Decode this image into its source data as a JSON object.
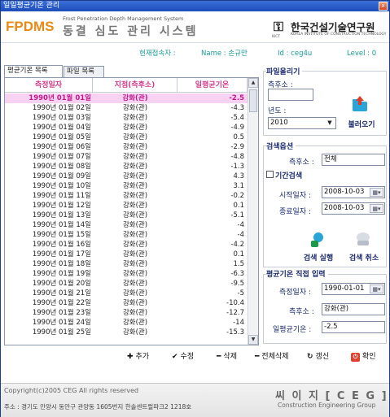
{
  "window": {
    "title": "일일평균기온 관리",
    "close_glyph": "x"
  },
  "header": {
    "logo": "FPDMS",
    "logo_subtitle": "Frost Penetration Depth Management System",
    "logo_title": "동결 심도 관리 시스템",
    "org_name": "한국건설기술연구원",
    "org_english": "KOREA INSTITUTE OF CONSTRUCTION TECHNOLOGY",
    "org_mark": "KICT"
  },
  "userbar": {
    "current_user_label": "현재접속자 :",
    "name_label": "Name : 손규만",
    "id_label": "Id : ceg4u",
    "level_label": "Level : 0"
  },
  "tabs": [
    {
      "label": "평균기온 목록",
      "active": true
    },
    {
      "label": "파일 목록",
      "active": false
    }
  ],
  "grid": {
    "columns": [
      "측정일자",
      "지점(측후소)",
      "일평균기온"
    ],
    "rows": [
      {
        "date": "1990년 01월 01일",
        "site": "강화(관)",
        "temp": "-2.5",
        "selected": true
      },
      {
        "date": "1990년 01월 02일",
        "site": "강화(관)",
        "temp": "-4.3"
      },
      {
        "date": "1990년 01월 03일",
        "site": "강화(관)",
        "temp": "-5.4"
      },
      {
        "date": "1990년 01월 04일",
        "site": "강화(관)",
        "temp": "-4.9"
      },
      {
        "date": "1990년 01월 05일",
        "site": "강화(관)",
        "temp": "0.5"
      },
      {
        "date": "1990년 01월 06일",
        "site": "강화(관)",
        "temp": "-2.9"
      },
      {
        "date": "1990년 01월 07일",
        "site": "강화(관)",
        "temp": "-4.8"
      },
      {
        "date": "1990년 01월 08일",
        "site": "강화(관)",
        "temp": "-1.3"
      },
      {
        "date": "1990년 01월 09일",
        "site": "강화(관)",
        "temp": "4.3"
      },
      {
        "date": "1990년 01월 10일",
        "site": "강화(관)",
        "temp": "3.1"
      },
      {
        "date": "1990년 01월 11일",
        "site": "강화(관)",
        "temp": "-0.2"
      },
      {
        "date": "1990년 01월 12일",
        "site": "강화(관)",
        "temp": "0.1"
      },
      {
        "date": "1990년 01월 13일",
        "site": "강화(관)",
        "temp": "-5.1"
      },
      {
        "date": "1990년 01월 14일",
        "site": "강화(관)",
        "temp": "-4"
      },
      {
        "date": "1990년 01월 15일",
        "site": "강화(관)",
        "temp": "-4"
      },
      {
        "date": "1990년 01월 16일",
        "site": "강화(관)",
        "temp": "-4.2"
      },
      {
        "date": "1990년 01월 17일",
        "site": "강화(관)",
        "temp": "0.1"
      },
      {
        "date": "1990년 01월 18일",
        "site": "강화(관)",
        "temp": "1.5"
      },
      {
        "date": "1990년 01월 19일",
        "site": "강화(관)",
        "temp": "-6.3"
      },
      {
        "date": "1990년 01월 20일",
        "site": "강화(관)",
        "temp": "-9.5"
      },
      {
        "date": "1990년 01월 21일",
        "site": "강화(관)",
        "temp": "-5"
      },
      {
        "date": "1990년 01월 22일",
        "site": "강화(관)",
        "temp": "-10.4"
      },
      {
        "date": "1990년 01월 23일",
        "site": "강화(관)",
        "temp": "-12.7"
      },
      {
        "date": "1990년 01월 24일",
        "site": "강화(관)",
        "temp": "-14"
      },
      {
        "date": "1990년 01월 25일",
        "site": "강화(관)",
        "temp": "-15.3"
      }
    ]
  },
  "file_load": {
    "title": "파일올리기",
    "station_label": "측후소 :",
    "station_value": "",
    "year_label": "년도 :",
    "year_value": "2010",
    "load_button": "불러오기"
  },
  "search": {
    "title": "검색옵션",
    "station_label": "측후소 :",
    "station_value": "전체",
    "period_label": "기간검색",
    "start_label": "시작일자 :",
    "start_value": "2008-10-03",
    "end_label": "종료일자 :",
    "end_value": "2008-10-03",
    "run_button": "검색 실행",
    "cancel_button": "검색 취소"
  },
  "direct_input": {
    "title": "평균기온 직접 입력",
    "date_label": "측정일자 :",
    "date_value": "1990-01-01",
    "station_label": "측후소 :",
    "station_value": "강화(관)",
    "temp_label": "일평균기온 :",
    "temp_value": "-2.5"
  },
  "toolbar": {
    "add": "추가",
    "edit": "수정",
    "delete": "삭제",
    "delete_all": "전체삭제",
    "refresh": "갱신",
    "confirm": "확인"
  },
  "footer": {
    "copyright": "Copyright(c)2005 CEG All rights reserved",
    "address": "주소 : 경기도 안양시 동안구 관양동 1605번지 한솔센트럴파크2 1218호",
    "brand": "씨 이 지 [ C E G ]",
    "brand_sub": "Construction  Engineering Group"
  },
  "colors": {
    "title_bar": "#1d4cb8",
    "header_pink": "#d23a8a",
    "selected_row": "#f7d2f2",
    "label_navy": "#1a2a6c",
    "userbar_teal": "#1a9a96",
    "logo_orange": "#e88a18"
  }
}
